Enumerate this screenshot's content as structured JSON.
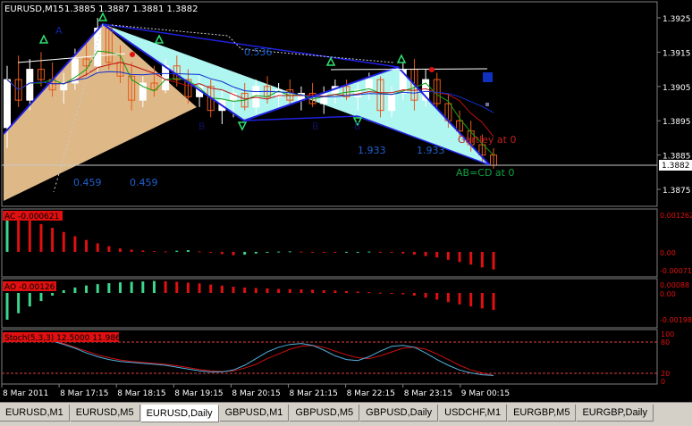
{
  "header": {
    "symbol": "EURUSD,M15",
    "ohlc": "1.3885 1.3887 1.3881 1.3882"
  },
  "colors": {
    "background": "#000000",
    "bull_candle": "#ffffff",
    "bear_candle": "#e85a1a",
    "pattern_fill_1": "#deb887",
    "pattern_fill_2": "#aff5f0",
    "pattern_line": "#2020e0",
    "ac_up": "#3cd68c",
    "ac_down": "#e01010",
    "ma_blue": "#1030d0",
    "ma_red": "#c01010",
    "ma_green": "#10a010",
    "stoch_main": "#50b0e0",
    "stoch_signal": "#d01010",
    "level_line": "#e04040"
  },
  "main_panel": {
    "price_ticks": [
      "1.3925",
      "1.3915",
      "1.3905",
      "1.3895",
      "1.3885",
      "1.3875"
    ],
    "current_price": "1.3882",
    "labels": {
      "a1": "A",
      "b1": "B",
      "b2": "B",
      "b3": "B",
      "r1": "0.536",
      "r2": "0.459",
      "r3": "0.459",
      "r4": "1.933",
      "r5": "1.933",
      "gartley": "Gartley at 0",
      "abcd": "AB=CD at 0"
    }
  },
  "ac_panel": {
    "label": "AC -0.000621",
    "ticks": [
      "0.001262",
      "0.00",
      "-0.000711"
    ]
  },
  "ao_panel": {
    "label": "AO -0.00126",
    "ticks": [
      "0.00088",
      "0.00",
      "-0.00198"
    ]
  },
  "stoch_panel": {
    "label": "Stoch(5,3,3) 12.5000 11.9865",
    "ticks": [
      "100",
      "80",
      "20",
      "0"
    ]
  },
  "time_axis": [
    "8 Mar 2011",
    "8 Mar 17:15",
    "8 Mar 18:15",
    "8 Mar 19:15",
    "8 Mar 20:15",
    "8 Mar 21:15",
    "8 Mar 22:15",
    "8 Mar 23:15",
    "9 Mar 00:15"
  ],
  "tabs": [
    "EURUSD,M1",
    "EURUSD,M5",
    "EURUSD,Daily",
    "GBPUSD,M1",
    "GBPUSD,M5",
    "GBPUSD,Daily",
    "USDCHF,M1",
    "EURGBP,M5",
    "EURGBP,Daily"
  ],
  "active_tab": 2,
  "chart_data": {
    "type": "candlestick",
    "symbol": "EURUSD",
    "timeframe": "M15",
    "ylim": [
      1.3871,
      1.393
    ],
    "candles": [
      {
        "o": 1.3893,
        "h": 1.3911,
        "l": 1.3887,
        "c": 1.3907
      },
      {
        "o": 1.3907,
        "h": 1.3914,
        "l": 1.3899,
        "c": 1.3901
      },
      {
        "o": 1.3901,
        "h": 1.3913,
        "l": 1.3898,
        "c": 1.391
      },
      {
        "o": 1.391,
        "h": 1.3915,
        "l": 1.3905,
        "c": 1.3907
      },
      {
        "o": 1.3907,
        "h": 1.3912,
        "l": 1.3902,
        "c": 1.3904
      },
      {
        "o": 1.3904,
        "h": 1.3909,
        "l": 1.39,
        "c": 1.3906
      },
      {
        "o": 1.3906,
        "h": 1.3916,
        "l": 1.3904,
        "c": 1.3913
      },
      {
        "o": 1.3913,
        "h": 1.3918,
        "l": 1.3908,
        "c": 1.3911
      },
      {
        "o": 1.3911,
        "h": 1.3925,
        "l": 1.3909,
        "c": 1.3922
      },
      {
        "o": 1.3922,
        "h": 1.3923,
        "l": 1.391,
        "c": 1.3912
      },
      {
        "o": 1.3912,
        "h": 1.3917,
        "l": 1.3906,
        "c": 1.3908
      },
      {
        "o": 1.3908,
        "h": 1.3912,
        "l": 1.3898,
        "c": 1.3901
      },
      {
        "o": 1.3901,
        "h": 1.3908,
        "l": 1.3899,
        "c": 1.3906
      },
      {
        "o": 1.3906,
        "h": 1.3911,
        "l": 1.3902,
        "c": 1.3904
      },
      {
        "o": 1.3904,
        "h": 1.3913,
        "l": 1.3903,
        "c": 1.3911
      },
      {
        "o": 1.3911,
        "h": 1.3914,
        "l": 1.3905,
        "c": 1.3907
      },
      {
        "o": 1.3907,
        "h": 1.391,
        "l": 1.39,
        "c": 1.3902
      },
      {
        "o": 1.3902,
        "h": 1.3908,
        "l": 1.3899,
        "c": 1.3905
      },
      {
        "o": 1.3905,
        "h": 1.3907,
        "l": 1.3896,
        "c": 1.3898
      },
      {
        "o": 1.3898,
        "h": 1.3904,
        "l": 1.3894,
        "c": 1.3901
      },
      {
        "o": 1.3901,
        "h": 1.3905,
        "l": 1.3896,
        "c": 1.3903
      },
      {
        "o": 1.3903,
        "h": 1.3906,
        "l": 1.3898,
        "c": 1.3899
      },
      {
        "o": 1.3899,
        "h": 1.3907,
        "l": 1.3897,
        "c": 1.3905
      },
      {
        "o": 1.3905,
        "h": 1.3908,
        "l": 1.39,
        "c": 1.3902
      },
      {
        "o": 1.3902,
        "h": 1.3906,
        "l": 1.3899,
        "c": 1.3904
      },
      {
        "o": 1.3904,
        "h": 1.3907,
        "l": 1.39,
        "c": 1.3901
      },
      {
        "o": 1.3901,
        "h": 1.3905,
        "l": 1.3898,
        "c": 1.3903
      },
      {
        "o": 1.3903,
        "h": 1.3906,
        "l": 1.3899,
        "c": 1.39
      },
      {
        "o": 1.39,
        "h": 1.3905,
        "l": 1.3897,
        "c": 1.3903
      },
      {
        "o": 1.3903,
        "h": 1.3907,
        "l": 1.39,
        "c": 1.3905
      },
      {
        "o": 1.3905,
        "h": 1.3907,
        "l": 1.3901,
        "c": 1.3902
      },
      {
        "o": 1.3902,
        "h": 1.3906,
        "l": 1.3898,
        "c": 1.3904
      },
      {
        "o": 1.3904,
        "h": 1.3909,
        "l": 1.3901,
        "c": 1.3907
      },
      {
        "o": 1.3907,
        "h": 1.3908,
        "l": 1.3896,
        "c": 1.3898
      },
      {
        "o": 1.3898,
        "h": 1.3905,
        "l": 1.3896,
        "c": 1.3903
      },
      {
        "o": 1.3903,
        "h": 1.3912,
        "l": 1.3901,
        "c": 1.391
      },
      {
        "o": 1.391,
        "h": 1.3913,
        "l": 1.3898,
        "c": 1.3901
      },
      {
        "o": 1.3901,
        "h": 1.391,
        "l": 1.3899,
        "c": 1.3907
      },
      {
        "o": 1.3907,
        "h": 1.3909,
        "l": 1.3899,
        "c": 1.39
      },
      {
        "o": 1.39,
        "h": 1.3903,
        "l": 1.3893,
        "c": 1.3895
      },
      {
        "o": 1.3895,
        "h": 1.3898,
        "l": 1.389,
        "c": 1.3892
      },
      {
        "o": 1.3892,
        "h": 1.3895,
        "l": 1.3886,
        "c": 1.3888
      },
      {
        "o": 1.3888,
        "h": 1.3891,
        "l": 1.3883,
        "c": 1.3885
      },
      {
        "o": 1.3885,
        "h": 1.3887,
        "l": 1.3881,
        "c": 1.3882
      }
    ],
    "ac": [
      0.00126,
      0.0012,
      0.0011,
      0.00098,
      0.00085,
      0.0007,
      0.00055,
      0.00042,
      0.0003,
      0.0002,
      0.00012,
      8e-05,
      5e-05,
      3e-05,
      2e-05,
      4e-05,
      6e-05,
      2e-05,
      -2e-05,
      -8e-05,
      -0.00012,
      -0.0001,
      -6e-05,
      -2e-05,
      1e-05,
      2e-05,
      1e-05,
      0.0,
      -1e-05,
      -2e-05,
      -1e-05,
      0.0,
      1e-05,
      -1e-05,
      -3e-05,
      -6e-05,
      -0.0001,
      -0.00015,
      -0.0002,
      -0.00028,
      -0.00036,
      -0.00045,
      -0.00055,
      -0.00062
    ],
    "ao": [
      -0.00198,
      -0.0015,
      -0.001,
      -0.0006,
      -0.0002,
      0.0002,
      0.0004,
      0.00055,
      0.00065,
      0.00072,
      0.00078,
      0.00082,
      0.00085,
      0.00088,
      0.00086,
      0.00082,
      0.00076,
      0.0007,
      0.00062,
      0.00054,
      0.00046,
      0.0004,
      0.00036,
      0.00034,
      0.0003,
      0.00028,
      0.00026,
      0.00024,
      0.0002,
      0.00018,
      0.00014,
      0.0001,
      6e-05,
      2e-05,
      -2e-05,
      -0.0001,
      -0.0002,
      -0.00035,
      -0.0005,
      -0.00068,
      -0.00085,
      -0.001,
      -0.00115,
      -0.00126
    ],
    "stoch_main": [
      95,
      93,
      92,
      90,
      85,
      78,
      70,
      60,
      52,
      46,
      42,
      40,
      38,
      36,
      34,
      30,
      26,
      22,
      20,
      20,
      24,
      34,
      48,
      62,
      72,
      78,
      80,
      76,
      66,
      54,
      46,
      44,
      52,
      64,
      74,
      76,
      72,
      60,
      46,
      34,
      24,
      18,
      14,
      12.5
    ],
    "stoch_signal": [
      92,
      93,
      92,
      90,
      86,
      80,
      72,
      64,
      56,
      50,
      45,
      42,
      40,
      38,
      36,
      33,
      29,
      25,
      22,
      21,
      22,
      28,
      36,
      48,
      58,
      68,
      74,
      76,
      72,
      64,
      56,
      50,
      48,
      54,
      62,
      70,
      72,
      68,
      58,
      46,
      34,
      24,
      18,
      12
    ]
  }
}
